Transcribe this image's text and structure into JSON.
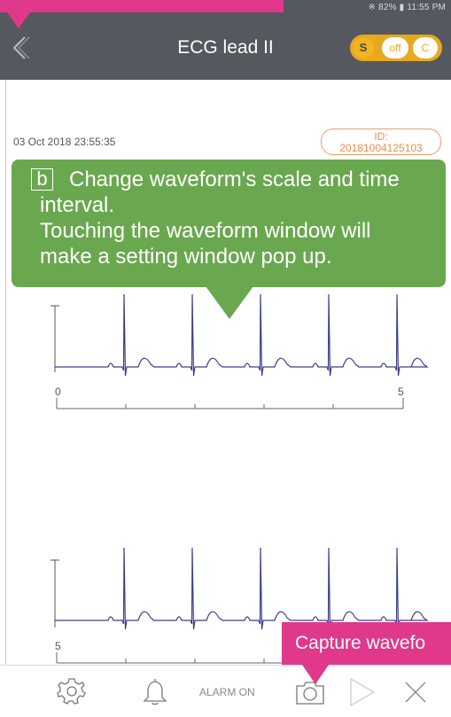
{
  "status_bar": {
    "text": "※ 82% ▮ 11:55 PM"
  },
  "header": {
    "title": "ECG lead II",
    "mode_s": "S",
    "mode_off": "off",
    "mode_c": "C"
  },
  "record": {
    "timestamp": "03 Oct 2018 23:55:35",
    "id_label": "ID:",
    "id_value": "20181004125103"
  },
  "tutorial": {
    "letter": "b",
    "line1": "Change waveform's scale and time",
    "line2": "interval.",
    "line3": "Touching the waveform window will",
    "line4": "make a setting window pop up."
  },
  "waveform1": {
    "axis_start": "0",
    "axis_end": "5"
  },
  "waveform2": {
    "axis_start": "5"
  },
  "capture_callout": {
    "text": "Capture wavefo"
  },
  "toolbar": {
    "alarm_label": "ALARM ON"
  },
  "colors": {
    "header_bg": "#55585e",
    "accent_orange": "#e7a91d",
    "callout_green": "#6aa84f",
    "highlight_pink": "#e0388a",
    "ecg_trace": "#3b3f8c"
  }
}
